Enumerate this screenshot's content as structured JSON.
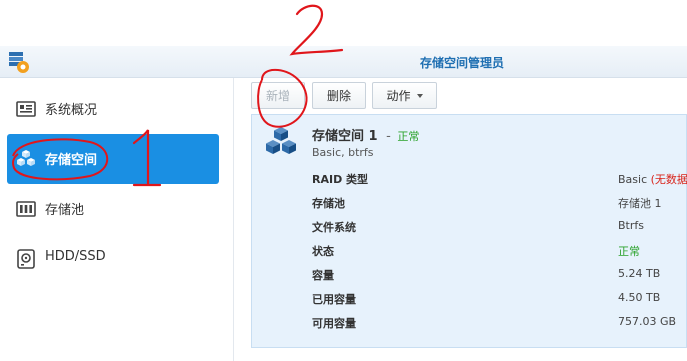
{
  "window": {
    "title": "存储空间管理员",
    "app_icon": "storage-manager-icon"
  },
  "sidebar": {
    "items": [
      {
        "label": "系统概况",
        "icon": "overview-icon",
        "active": false
      },
      {
        "label": "存储空间",
        "icon": "volume-cubes-icon",
        "active": true
      },
      {
        "label": "存储池",
        "icon": "storage-pool-icon",
        "active": false
      },
      {
        "label": "HDD/SSD",
        "icon": "hdd-icon",
        "active": false
      }
    ]
  },
  "toolbar": {
    "create_label": "新增",
    "delete_label": "删除",
    "action_label": "动作"
  },
  "volume": {
    "name": "存储空间 1",
    "separator": "-",
    "status": "正常",
    "subtitle": "Basic, btrfs",
    "details": [
      {
        "key": "RAID 类型",
        "value": "Basic",
        "note": "(无数据"
      },
      {
        "key": "存储池",
        "value": "存储池 1"
      },
      {
        "key": "文件系统",
        "value": "Btrfs"
      },
      {
        "key": "状态",
        "value": "正常",
        "ok": true
      },
      {
        "key": "容量",
        "value": "5.24 TB"
      },
      {
        "key": "已用容量",
        "value": "4.50 TB"
      },
      {
        "key": "可用容量",
        "value": "757.03 GB"
      }
    ]
  },
  "annotations": {
    "number_top": "2",
    "number_side": "1"
  },
  "colors": {
    "accent": "#1a8fe3",
    "title": "#1f6fb2",
    "ok": "#2aa22a",
    "warn": "#d9251b",
    "annotation": "#e0161b",
    "panel": "#e7f2fc"
  }
}
